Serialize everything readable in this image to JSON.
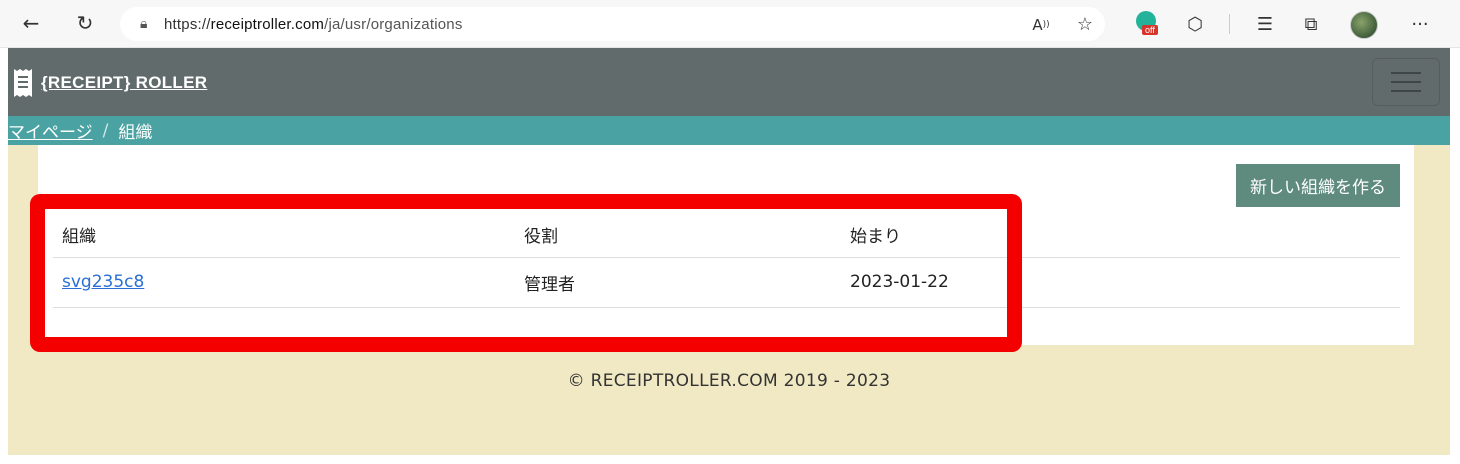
{
  "browser": {
    "url_prefix": "https://",
    "url_host": "receiptroller.com",
    "url_path": "/ja/usr/organizations",
    "extension_badge": "off"
  },
  "header": {
    "brand": "{RECEIPT} ROLLER"
  },
  "breadcrumb": {
    "items": [
      "マイページ",
      "組織"
    ],
    "separator": "/"
  },
  "main": {
    "new_org_button": "新しい組織を作る",
    "table": {
      "columns": [
        "組織",
        "役割",
        "始まり"
      ],
      "rows": [
        {
          "organization": "svg235c8",
          "role": "管理者",
          "started": "2023-01-22"
        }
      ]
    }
  },
  "footer": {
    "copyright": "© RECEIPTROLLER.COM 2019 - 2023"
  },
  "colors": {
    "header_bg": "#626b6c",
    "breadcrumb_bg": "#4aa3a2",
    "page_bg": "#f0e9c3",
    "button_bg": "#5e8b7e",
    "highlight": "#f50000",
    "link": "#2a6fd6"
  }
}
